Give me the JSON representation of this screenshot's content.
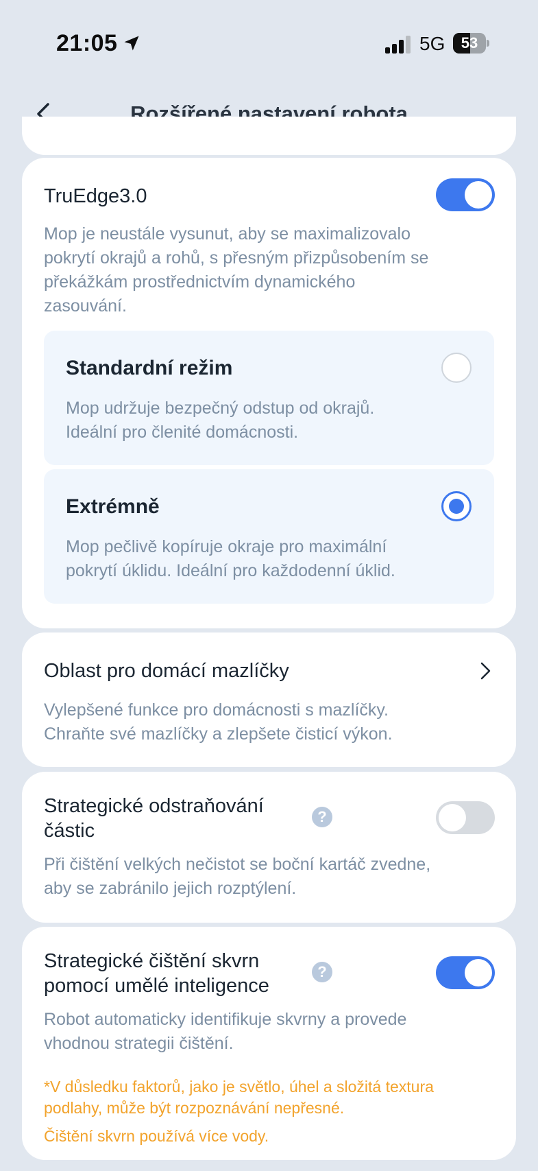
{
  "status_bar": {
    "time": "21:05",
    "network": "5G",
    "battery_level": 53,
    "battery_label": "53"
  },
  "nav": {
    "title": "Rozšířené nastavení robota",
    "back_icon": "chevron-left-icon"
  },
  "truedge": {
    "title": "TruEdge3.0",
    "enabled": true,
    "description_lines": [
      "Mop je neustále vysunut, aby se maximalizovalo",
      "pokrytí okrajů a rohů, s přesným přizpůsobením se",
      "překážkám prostřednictvím dynamického",
      "zasouvání."
    ],
    "options": [
      {
        "title": "Standardní režim",
        "selected": false,
        "description_lines": [
          "Mop udržuje bezpečný odstup od okrajů.",
          "Ideální pro členité domácnosti."
        ]
      },
      {
        "title": "Extrémně",
        "selected": true,
        "description_lines": [
          "Mop pečlivě kopíruje okraje pro maximální",
          "pokrytí úklidu. Ideální pro každodenní úklid."
        ]
      }
    ]
  },
  "pets": {
    "title": "Oblast pro domácí mazlíčky",
    "description_lines": [
      "Vylepšené funkce pro domácnosti s mazlíčky.",
      "Chraňte své mazlíčky a zlepšete čisticí výkon."
    ]
  },
  "particles": {
    "title_lines": [
      "Strategické odstraňování",
      "částic"
    ],
    "enabled": false,
    "help": "?",
    "description_lines": [
      "Při čištění velkých nečistot se boční kartáč zvedne,",
      "aby se zabránilo jejich rozptýlení."
    ]
  },
  "ai_stains": {
    "title_lines": [
      "Strategické čištění skvrn",
      "pomocí umělé inteligence"
    ],
    "enabled": true,
    "help": "?",
    "description_lines": [
      "Robot automaticky identifikuje skvrny a provede",
      "vhodnou strategii čištění."
    ],
    "note_lines": [
      "*V důsledku faktorů, jako je světlo, úhel a složitá textura",
      "podlahy, může být rozpoznávání nepřesné."
    ],
    "note2": "Čištění skvrn používá více vody."
  },
  "colors": {
    "accent": "#3d78ee",
    "warning": "#f2a32c",
    "muted_text": "#7d8fa3",
    "background": "#e1e7ef"
  }
}
